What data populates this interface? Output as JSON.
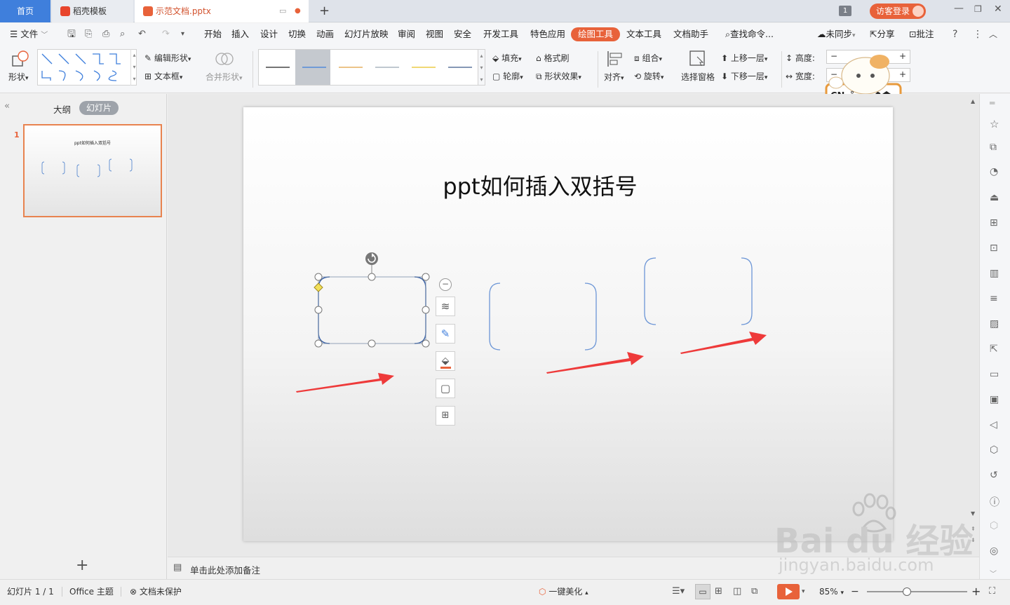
{
  "tabs": {
    "home": "首页",
    "template": "稻壳模板",
    "document": "示范文档.pptx",
    "window_count": "1",
    "login": "访客登录"
  },
  "menu": {
    "file": "文件",
    "items": [
      "开始",
      "插入",
      "设计",
      "切换",
      "动画",
      "幻灯片放映",
      "审阅",
      "视图",
      "安全",
      "开发工具",
      "特色应用",
      "绘图工具",
      "文本工具",
      "文档助手"
    ],
    "search": "查找命令...",
    "sync": "未同步",
    "share": "分享",
    "comment": "批注"
  },
  "ribbon": {
    "shape": "形状",
    "edit_shape": "编辑形状",
    "text_box": "文本框",
    "merge_shape": "合并形状",
    "fill": "填充",
    "format_brush": "格式刷",
    "outline": "轮廓",
    "shape_effect": "形状效果",
    "align": "对齐",
    "group": "组合",
    "rotate": "旋转",
    "selection_pane": "选择窗格",
    "bring_forward": "上移一层",
    "send_backward": "下移一层",
    "height": "高度:",
    "width": "宽度:",
    "line_style_colors": [
      "#222222",
      "#3f7fdc",
      "#e0a040",
      "#9aa6b2",
      "#e8c020",
      "#3c5a8a"
    ]
  },
  "ime": {
    "label": "CN"
  },
  "left_pane": {
    "outline_tab": "大纲",
    "slides_tab": "幻灯片",
    "slide_number": "1",
    "thumb_title": "ppt如何插入双括号",
    "add": "+"
  },
  "slide": {
    "title": "ppt如何插入双括号"
  },
  "notes": {
    "placeholder": "单击此处添加备注"
  },
  "status": {
    "slide_info": "幻灯片 1 / 1",
    "theme": "Office 主题",
    "protect": "文档未保护",
    "beautify": "一键美化",
    "zoom": "85%"
  },
  "watermark": {
    "brand": "Bai du 经验",
    "url": "jingyan.baidu.com"
  },
  "colors": {
    "accent": "#e8623a",
    "tab_blue": "#3f7fdc",
    "shape_blue": "#5b8bd0",
    "arrow_red": "#ee3333"
  }
}
